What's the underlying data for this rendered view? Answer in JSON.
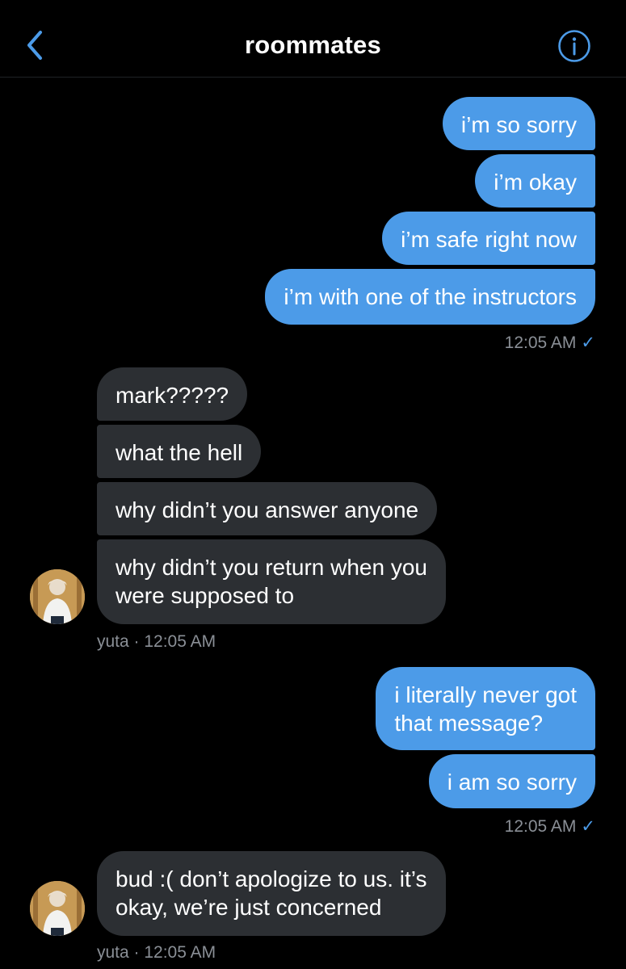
{
  "header": {
    "title": "roommates",
    "back_icon": "chevron-left-icon",
    "info_icon": "info-circle-icon",
    "accent_color": "#4c9be8"
  },
  "colors": {
    "outgoing_bubble": "#4c9be8",
    "incoming_bubble": "#2c2f33",
    "background": "#000000",
    "meta_text": "#8a8f96"
  },
  "messages": {
    "group1": [
      "i’m so sorry",
      "i’m okay",
      "i’m safe right now",
      "i’m with one of the instructors"
    ],
    "group1_time": "12:05 AM",
    "group2": [
      "mark?????",
      "what the hell",
      "why didn’t you answer anyone",
      "why didn’t you return when you",
      "were supposed to"
    ],
    "group2_meta": "yuta · 12:05 AM",
    "group3": [
      "i literally never got",
      "that message?",
      "i am so sorry"
    ],
    "group3_time": "12:05 AM",
    "group4": [
      "bud :( don’t apologize to us. it’s",
      "okay, we’re just concerned"
    ],
    "group4_meta": "yuta · 12:05 AM",
    "read_check": "✓"
  }
}
